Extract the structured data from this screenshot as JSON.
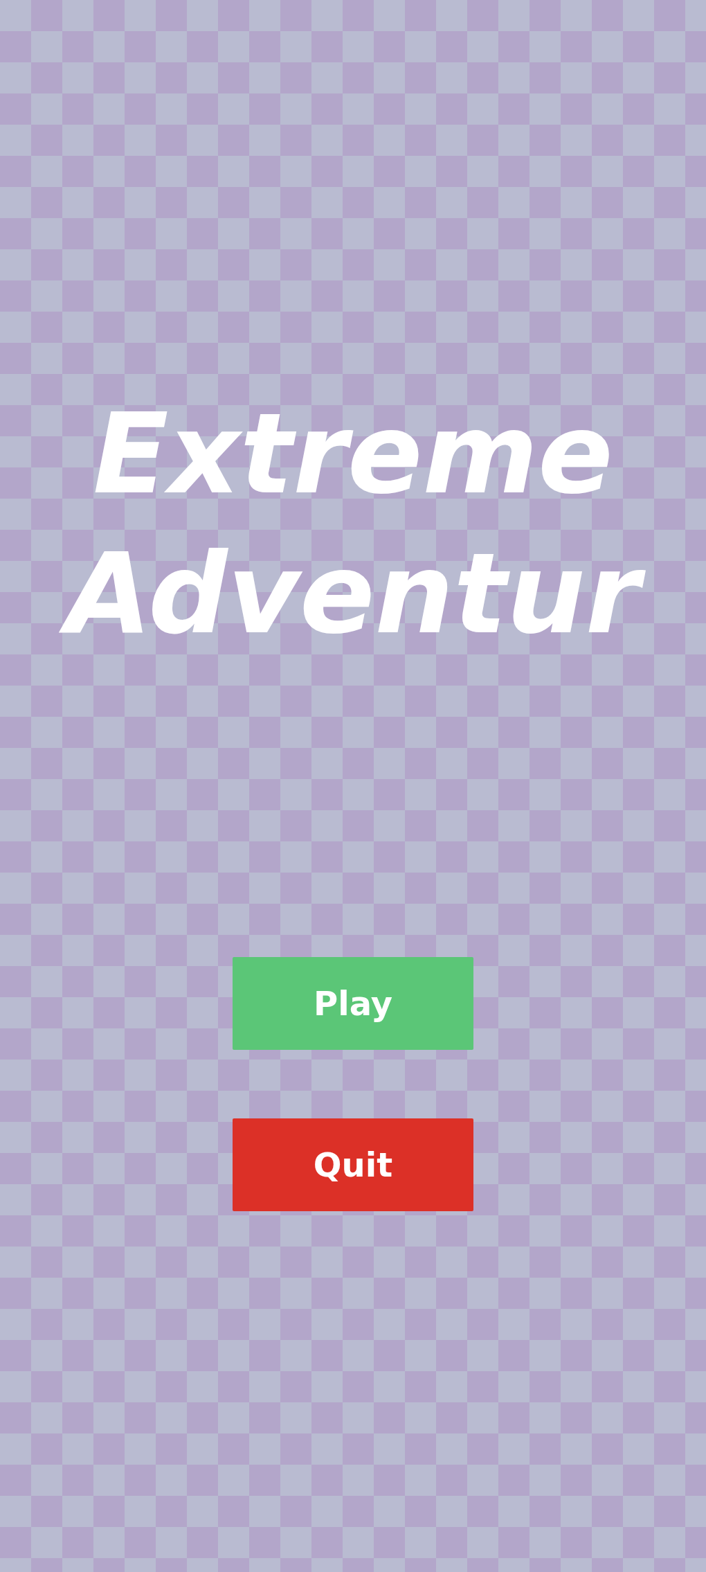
{
  "title": "Extreme Adventur",
  "buttons": [
    {
      "label": "Play",
      "color": "#5bc677"
    },
    {
      "label": "Quit",
      "color": "#dc3027"
    }
  ]
}
